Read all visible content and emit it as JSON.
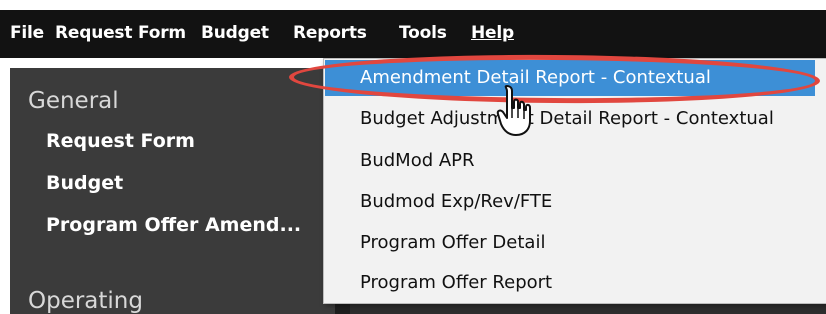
{
  "menu": {
    "file": "File",
    "request_form": "Request Form",
    "budget": "Budget",
    "reports": "Reports",
    "tools": "Tools",
    "help": "Help"
  },
  "sidebar": {
    "general": "General",
    "items": [
      "Request Form",
      "Budget",
      "Program Offer Amend..."
    ],
    "operating": "Operating"
  },
  "reports_menu": {
    "items": [
      "Amendment Detail Report - Contextual",
      "Budget Adjustment Detail Report - Contextual",
      "BudMod APR",
      "Budmod Exp/Rev/FTE",
      "Program Offer Detail",
      "Program Offer Report"
    ]
  },
  "colors": {
    "menubar": "#121212",
    "sidebar": "#3b3b3b",
    "dropdown": "#f2f2f2",
    "highlight": "#3d8fd6",
    "annotation": "#e1473f"
  },
  "icons": {
    "cursor": "hand-pointer-icon"
  }
}
